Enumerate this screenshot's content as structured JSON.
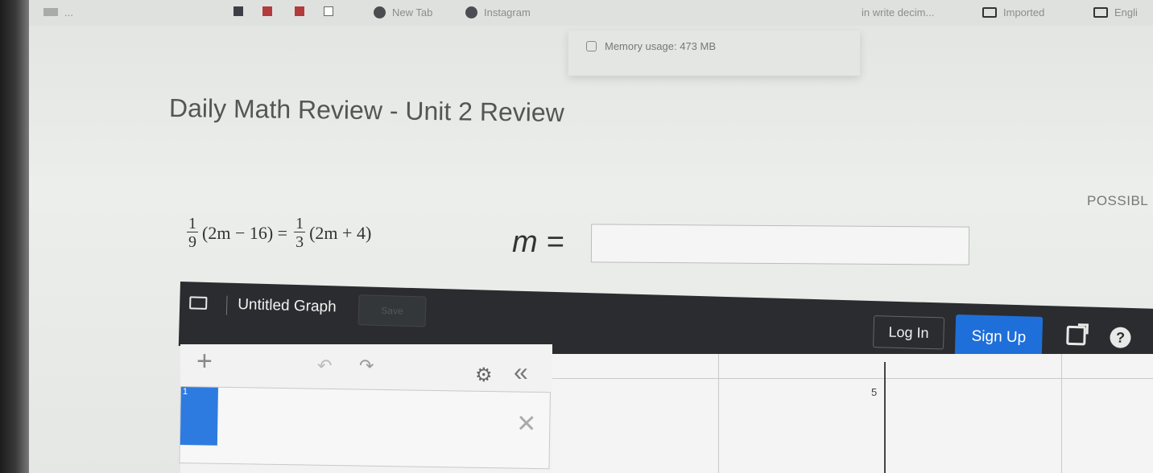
{
  "bookmarks": {
    "items": [
      {
        "label": "...",
        "icon": "bookmark-icon"
      },
      {
        "label": "New Tab",
        "icon": "globe-icon"
      },
      {
        "label": "Instagram",
        "icon": "globe-icon"
      },
      {
        "label": "in write decim...",
        "icon": ""
      },
      {
        "label": "Imported",
        "icon": "folder-icon"
      },
      {
        "label": "Engli",
        "icon": "folder-icon"
      }
    ]
  },
  "tooltip": {
    "memory": "Memory usage: 473 MB"
  },
  "page": {
    "title": "Daily Math Review - Unit 2 Review",
    "possible_label": "POSSIBL"
  },
  "problem": {
    "frac1_num": "1",
    "frac1_den": "9",
    "left_rest": "(2m − 16) =",
    "frac2_num": "1",
    "frac2_den": "3",
    "right_rest": "(2m + 4)",
    "answer_label": "m =",
    "answer_value": ""
  },
  "calculator": {
    "graph_title": "Untitled Graph",
    "save_label": "Save",
    "login_label": "Log In",
    "signup_label": "Sign Up",
    "help_label": "?",
    "expression_index": "1",
    "axis_tick": "5"
  },
  "colors": {
    "toolbar": "#2a2c2f",
    "signup": "#1e6fd9",
    "expression_accent": "#2d7be0"
  }
}
